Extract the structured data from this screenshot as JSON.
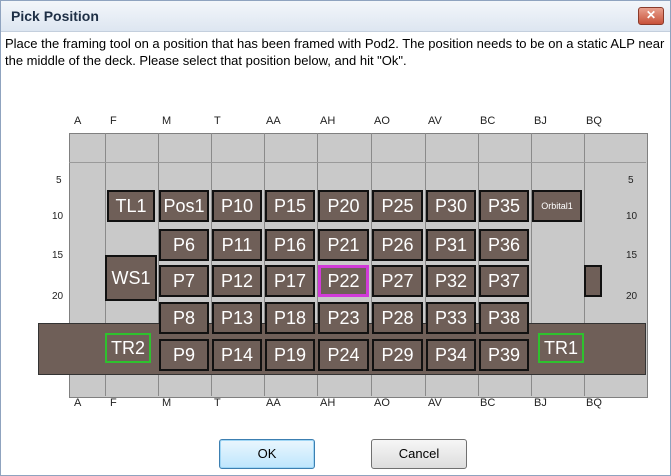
{
  "dialog": {
    "title": "Pick Position",
    "close_icon": "close-icon",
    "instructions": "Place the framing tool on a position that has been framed with Pod2. The position needs to be on a static ALP near the middle of the deck. Please select that position below, and hit \"Ok\"."
  },
  "deck": {
    "columns": [
      "A",
      "F",
      "M",
      "T",
      "AA",
      "AH",
      "AO",
      "AV",
      "BC",
      "BJ",
      "BQ"
    ],
    "rows": [
      "5",
      "10",
      "15",
      "20"
    ],
    "positions": {
      "TL1": "TL1",
      "Pos1": "Pos1",
      "P10": "P10",
      "P15": "P15",
      "P20": "P20",
      "P25": "P25",
      "P30": "P30",
      "P35": "P35",
      "Orbital1": "Orbital1",
      "P6": "P6",
      "P11": "P11",
      "P16": "P16",
      "P21": "P21",
      "P26": "P26",
      "P31": "P31",
      "P36": "P36",
      "WS1": "WS1",
      "P7": "P7",
      "P12": "P12",
      "P17": "P17",
      "P22": "P22",
      "P27": "P27",
      "P32": "P32",
      "P37": "P37",
      "P8": "P8",
      "P13": "P13",
      "P18": "P18",
      "P23": "P23",
      "P28": "P28",
      "P33": "P33",
      "P38": "P38",
      "TR2": "TR2",
      "P9": "P9",
      "P14": "P14",
      "P19": "P19",
      "P24": "P24",
      "P29": "P29",
      "P34": "P34",
      "P39": "P39",
      "TR1": "TR1"
    },
    "selected_position": "P22",
    "colors": {
      "position_fill": "#6f5f58",
      "selected_border": "#d13bd8",
      "transfer_border": "#2ec12e"
    }
  },
  "buttons": {
    "ok": "OK",
    "cancel": "Cancel"
  }
}
